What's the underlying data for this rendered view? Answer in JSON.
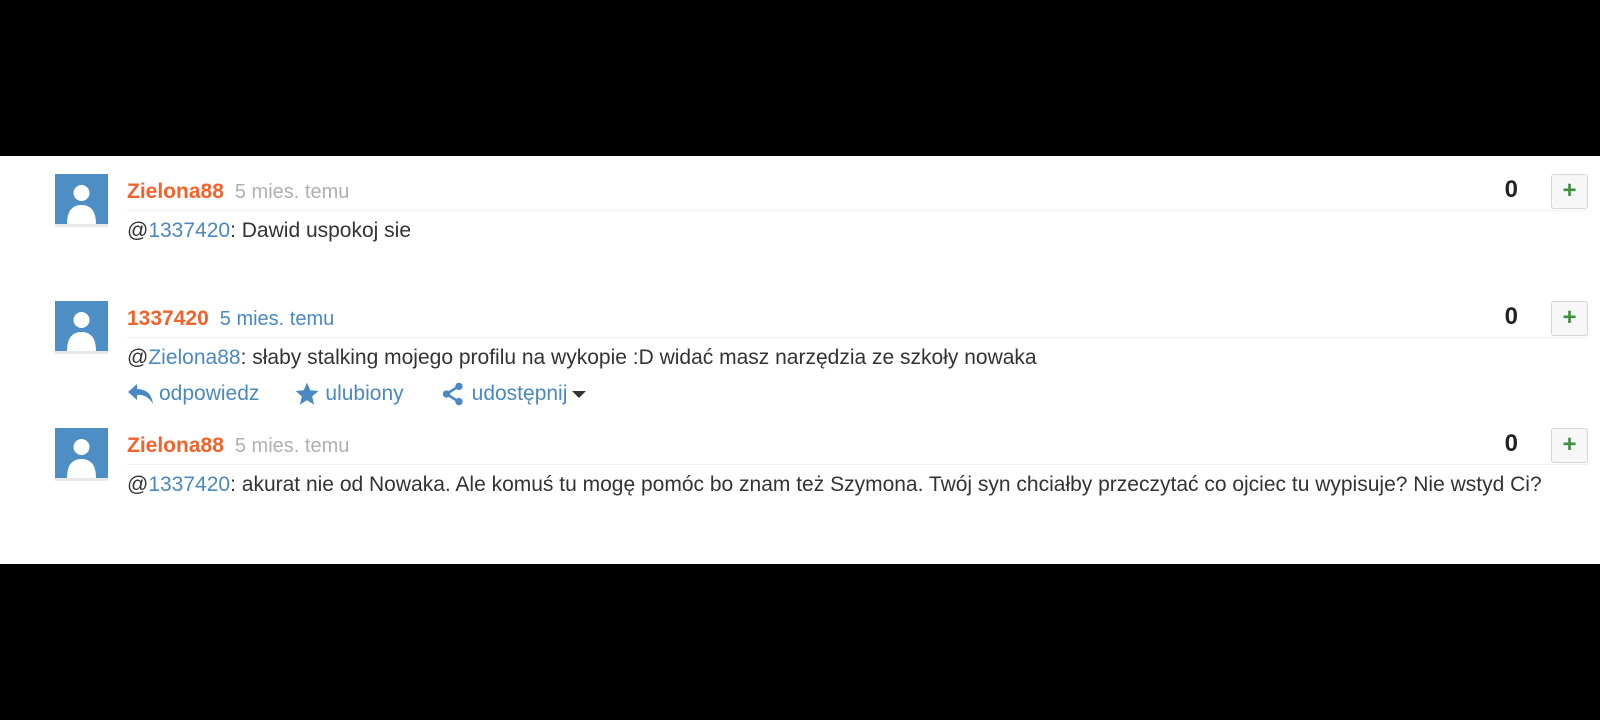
{
  "comments": [
    {
      "author": "Zielona88",
      "time": "5 mies. temu",
      "score": "0",
      "plus_label": "+",
      "mention_prefix": "@",
      "mention": "1337420",
      "text": ": Dawid uspokoj sie"
    },
    {
      "author": "1337420",
      "time": "5 mies. temu",
      "score": "0",
      "plus_label": "+",
      "mention_prefix": "@",
      "mention": "Zielona88",
      "text": ": słaby stalking mojego profilu na wykopie :D widać masz narzędzia ze szkoły nowaka",
      "actions": {
        "reply": "odpowiedz",
        "favorite": "ulubiony",
        "share": "udostępnij"
      }
    },
    {
      "author": "Zielona88",
      "time": "5 mies. temu",
      "score": "0",
      "plus_label": "+",
      "mention_prefix": "@",
      "mention": "1337420",
      "text": ": akurat nie od Nowaka. Ale komuś tu mogę pomóc bo znam też Szymona. Twój syn chciałby przeczytać co ojciec tu wypisuje? Nie wstyd Ci?"
    }
  ],
  "icons": {
    "avatar": "default-user-avatar",
    "reply": "reply-arrow-icon",
    "favorite": "star-icon",
    "share": "share-icon",
    "dropdown": "caret-down-icon"
  },
  "colors": {
    "author": "#f4622b",
    "link": "#4a88c3",
    "plus": "#3f8f3f",
    "avatar_bg": "#4d8fc4"
  }
}
